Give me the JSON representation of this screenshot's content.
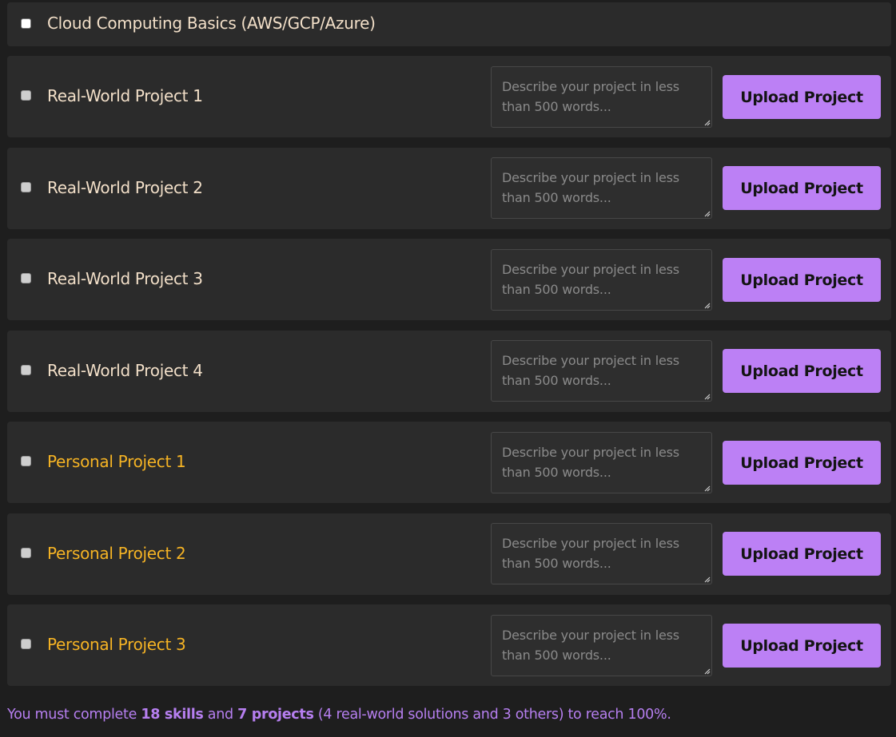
{
  "skill": {
    "label": "Cloud Computing Basics (AWS/GCP/Azure)",
    "checked": false
  },
  "projects": [
    {
      "label": "Real-World Project 1",
      "kind": "real-world",
      "placeholder": "Describe your project in less than 500 words...",
      "button": "Upload Project"
    },
    {
      "label": "Real-World Project 2",
      "kind": "real-world",
      "placeholder": "Describe your project in less than 500 words...",
      "button": "Upload Project"
    },
    {
      "label": "Real-World Project 3",
      "kind": "real-world",
      "placeholder": "Describe your project in less than 500 words...",
      "button": "Upload Project"
    },
    {
      "label": "Real-World Project 4",
      "kind": "real-world",
      "placeholder": "Describe your project in less than 500 words...",
      "button": "Upload Project"
    },
    {
      "label": "Personal Project 1",
      "kind": "personal",
      "placeholder": "Describe your project in less than 500 words...",
      "button": "Upload Project"
    },
    {
      "label": "Personal Project 2",
      "kind": "personal",
      "placeholder": "Describe your project in less than 500 words...",
      "button": "Upload Project"
    },
    {
      "label": "Personal Project 3",
      "kind": "personal",
      "placeholder": "Describe your project in less than 500 words...",
      "button": "Upload Project"
    }
  ],
  "footer": {
    "prefix": "You must complete ",
    "skills": "18 skills",
    "middle": " and ",
    "projects": "7 projects",
    "suffix": " (4 real-world solutions and 3 others) to reach 100%."
  },
  "colors": {
    "background": "#1e1e1e",
    "card": "#2b2b2b",
    "accent": "#bc80f5",
    "real_world_label": "#f2dfc8",
    "personal_label": "#f5b324",
    "footer_text": "#b67ff0"
  }
}
